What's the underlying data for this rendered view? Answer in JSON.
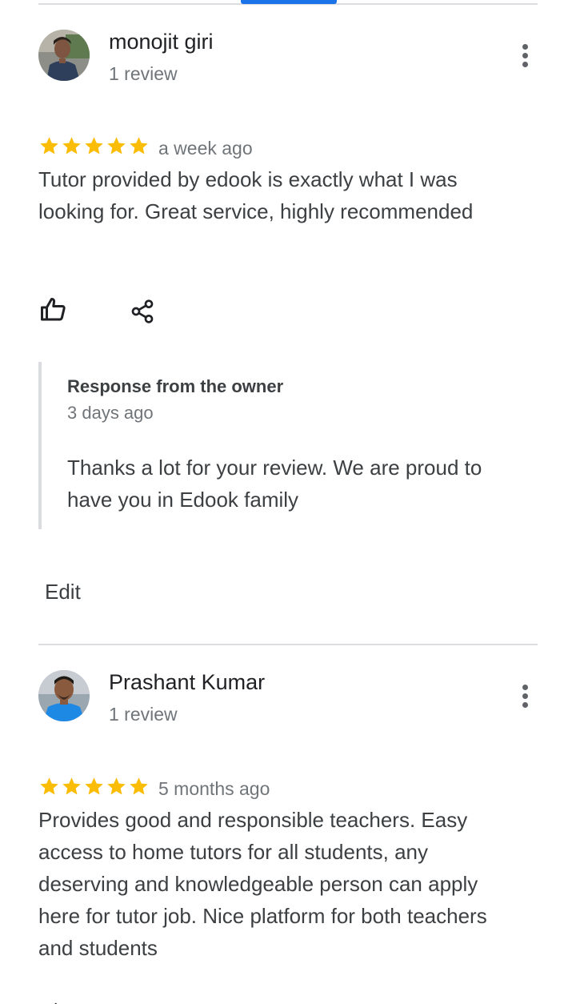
{
  "reviews": [
    {
      "name": "monojit giri",
      "review_count": "1 review",
      "stars": 5,
      "time": "a week ago",
      "text": "Tutor provided by edook is exactly what I was looking for. Great service, highly recommended",
      "owner_response": {
        "title": "Response from the owner",
        "time": "3 days ago",
        "text": "Thanks a lot for your review. We are proud to have you in Edook family"
      },
      "edit_label": "Edit"
    },
    {
      "name": "Prashant Kumar",
      "review_count": "1 review",
      "stars": 5,
      "time": "5 months ago",
      "text": "Provides good and responsible teachers. Easy access to home tutors for all students, any deserving and knowledgeable person can apply here for tutor job. Nice platform for both teachers and students"
    }
  ],
  "icons": {
    "like": "thumbs-up-icon",
    "share": "share-icon",
    "more": "more-vert-icon",
    "star": "star-icon"
  },
  "colors": {
    "star": "#fbbc04",
    "tab_indicator": "#1a73e8",
    "secondary_text": "#70757a"
  }
}
